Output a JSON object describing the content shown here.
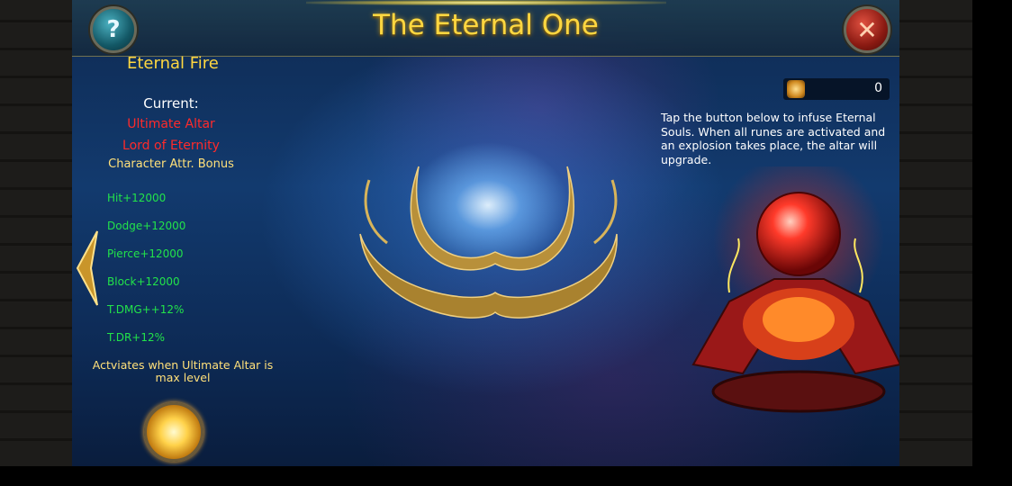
{
  "window": {
    "title": "The Eternal One"
  },
  "buttons": {
    "help_label": "?",
    "close_label": "✕"
  },
  "left_panel": {
    "heading": "Eternal Fire",
    "current_label": "Current:",
    "current_values": [
      "Ultimate Altar",
      "Lord of Eternity"
    ],
    "bonus_label": "Character Attr. Bonus",
    "attributes": [
      "Hit+12000",
      "Dodge+12000",
      "Pierce+12000",
      "Block+12000",
      "T.DMG++12%",
      "T.DR+12%"
    ],
    "activation_note": "Actviates when Ultimate Altar is max level"
  },
  "right_panel": {
    "counter_value": "0",
    "description": "Tap the button below to infuse Eternal Souls. When all runes are activated and an explosion takes place, the altar will upgrade."
  },
  "icons": {
    "help": "question-icon",
    "close": "close-icon",
    "nav_left": "chevron-left-icon",
    "counter": "soul-icon",
    "skill": "eternal-fire-icon"
  },
  "colors": {
    "title": "#ffd740",
    "red_text": "#ff2a2a",
    "green_text": "#22e34a",
    "gold_text": "#ffe07a"
  }
}
